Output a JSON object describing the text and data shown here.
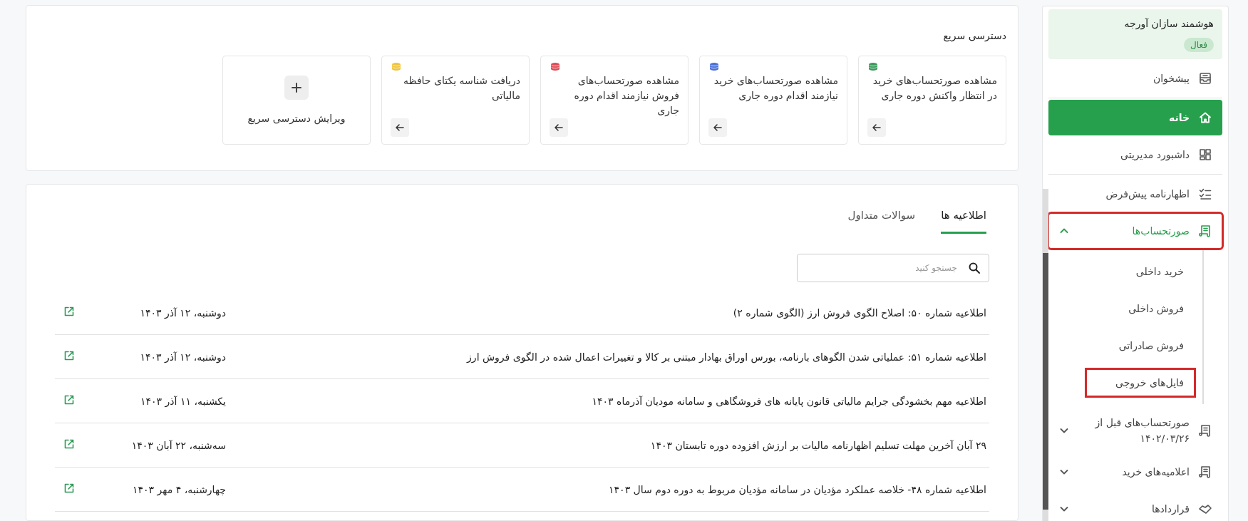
{
  "sidebar": {
    "organization": {
      "name": "هوشمند سازان آورجه",
      "status": "فعال"
    },
    "items": [
      {
        "kind": "link",
        "label": "پیشخوان",
        "selected": false,
        "highlighted": false
      },
      {
        "kind": "divider"
      },
      {
        "kind": "link",
        "label": "خانه",
        "selected": true,
        "highlighted": false
      },
      {
        "kind": "link",
        "label": "داشبورد مدیریتی",
        "selected": false,
        "highlighted": false
      },
      {
        "kind": "divider"
      },
      {
        "kind": "link",
        "label": "اظهارنامه پیش‌فرض",
        "selected": false,
        "highlighted": false
      },
      {
        "kind": "group",
        "label": "صورتحساب‌ها",
        "selected": false,
        "highlighted": true,
        "expanded": true,
        "children": [
          {
            "label": "خرید داخلی",
            "highlighted": false
          },
          {
            "label": "فروش داخلی",
            "highlighted": false
          },
          {
            "label": "فروش صادراتی",
            "highlighted": false
          },
          {
            "label": "فایل‌های خروجی",
            "highlighted": true
          }
        ]
      },
      {
        "kind": "group",
        "label": "صورتحساب‌های قبل از ۱۴۰۲/۰۳/۲۶",
        "selected": false,
        "highlighted": false,
        "expanded": false
      },
      {
        "kind": "group",
        "label": "اعلامیه‌های خرید",
        "selected": false,
        "highlighted": false,
        "expanded": false
      },
      {
        "kind": "group",
        "label": "قراردادها",
        "selected": false,
        "highlighted": false,
        "expanded": false
      }
    ]
  },
  "quick_access": {
    "title": "دسترسی سریع",
    "cards": [
      {
        "kind": "link",
        "title": "مشاهده صورتحساب‌های خرید در انتظار واکنش دوره جاری",
        "color": "#3a9a5c"
      },
      {
        "kind": "link",
        "title": "مشاهده صورتحساب‌های خرید نیازمند اقدام دوره جاری",
        "color": "#4a6fd8"
      },
      {
        "kind": "link",
        "title": "مشاهده صورتحساب‌های فروش نیازمند اقدام دوره جاری",
        "color": "#e04a55"
      },
      {
        "kind": "link",
        "title": "دریافت شناسه یکتای حافظه مالیاتی",
        "color": "#f0c43a"
      },
      {
        "kind": "edit",
        "title": "ویرایش دسترسی سریع"
      }
    ]
  },
  "announcements": {
    "tabs": [
      {
        "label": "اطلاعیه ها",
        "selected": true
      },
      {
        "label": "سوالات متداول",
        "selected": false
      }
    ],
    "search": {
      "placeholder": "جستجو کنید"
    },
    "rows": [
      {
        "title": "اطلاعیه شماره ۵۰: اصلاح الگوی فروش ارز (الگوی شماره ۲)",
        "date": "دوشنبه، ۱۲ آذر ۱۴۰۳"
      },
      {
        "title": "اطلاعیه شماره ۵۱: عملیاتی شدن الگوهای بارنامه، بورس اوراق بهادار مبتنی بر کالا و تغییرات اعمال شده در الگوی فروش ارز",
        "date": "دوشنبه، ۱۲ آذر ۱۴۰۳"
      },
      {
        "title": "اطلاعیه مهم بخشودگی جرایم مالیاتی قانون پایانه های فروشگاهی و سامانه مودیان آذرماه ۱۴۰۳",
        "date": "یکشنبه، ۱۱ آذر ۱۴۰۳"
      },
      {
        "title": "۲۹ آبان آخرین مهلت تسلیم اظهارنامه مالیات بر ارزش افزوده دوره تابستان ۱۴۰۳",
        "date": "سه‌شنبه، ۲۲ آبان ۱۴۰۳"
      },
      {
        "title": "اطلاعیه شماره ۴۸- خلاصه عملکرد مؤدیان در سامانه مؤدیان مربوط به دوره دوم سال ۱۴۰۳",
        "date": "چهارشنبه، ۴ مهر ۱۴۰۳"
      }
    ]
  }
}
